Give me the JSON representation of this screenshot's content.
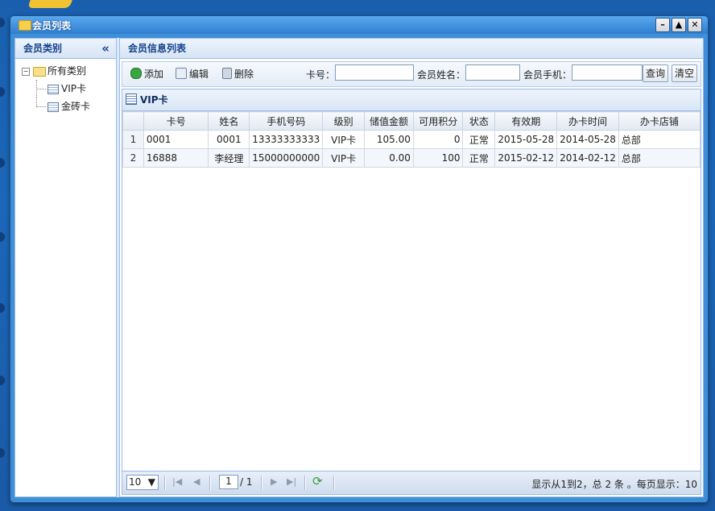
{
  "window": {
    "title": "会员列表",
    "btn_min": "–",
    "btn_max": "▲",
    "btn_close": "✕"
  },
  "west": {
    "title": "会员类别",
    "collapse": "«",
    "tree": {
      "root": "所有类别",
      "children": [
        "VIP卡",
        "金砖卡"
      ]
    }
  },
  "east": {
    "title": "会员信息列表"
  },
  "toolbar": {
    "add": "添加",
    "edit": "编辑",
    "delete": "删除",
    "card_label": "卡号：",
    "name_label": "会员姓名：",
    "phone_label": "会员手机：",
    "card_value": "",
    "name_value": "",
    "phone_value": "",
    "query": "查询",
    "clear": "清空"
  },
  "grid": {
    "title": "VIP卡",
    "columns": [
      "卡号",
      "姓名",
      "手机号码",
      "级别",
      "储值金额",
      "可用积分",
      "状态",
      "有效期",
      "办卡时间",
      "办卡店铺"
    ],
    "rows": [
      [
        "1",
        "0001",
        "0001",
        "13333333333",
        "VIP卡",
        "105.00",
        "0",
        "正常",
        "2015-05-28",
        "2014-05-28",
        "总部"
      ],
      [
        "2",
        "16888",
        "李经理",
        "15000000000",
        "VIP卡",
        "0.00",
        "100",
        "正常",
        "2015-02-12",
        "2014-02-12",
        "总部"
      ]
    ]
  },
  "pager": {
    "page_size": "10",
    "current_page": "1",
    "total_pages": "/ 1",
    "info": "显示从1到2，总 2 条 。每页显示：10"
  },
  "colors": {
    "accent": "#1b67b9",
    "header_text": "#15428b",
    "border": "#99bbe8"
  },
  "icons": {
    "add": "add-icon",
    "edit": "edit-icon",
    "delete": "trash-icon",
    "refresh": "refresh-icon"
  }
}
